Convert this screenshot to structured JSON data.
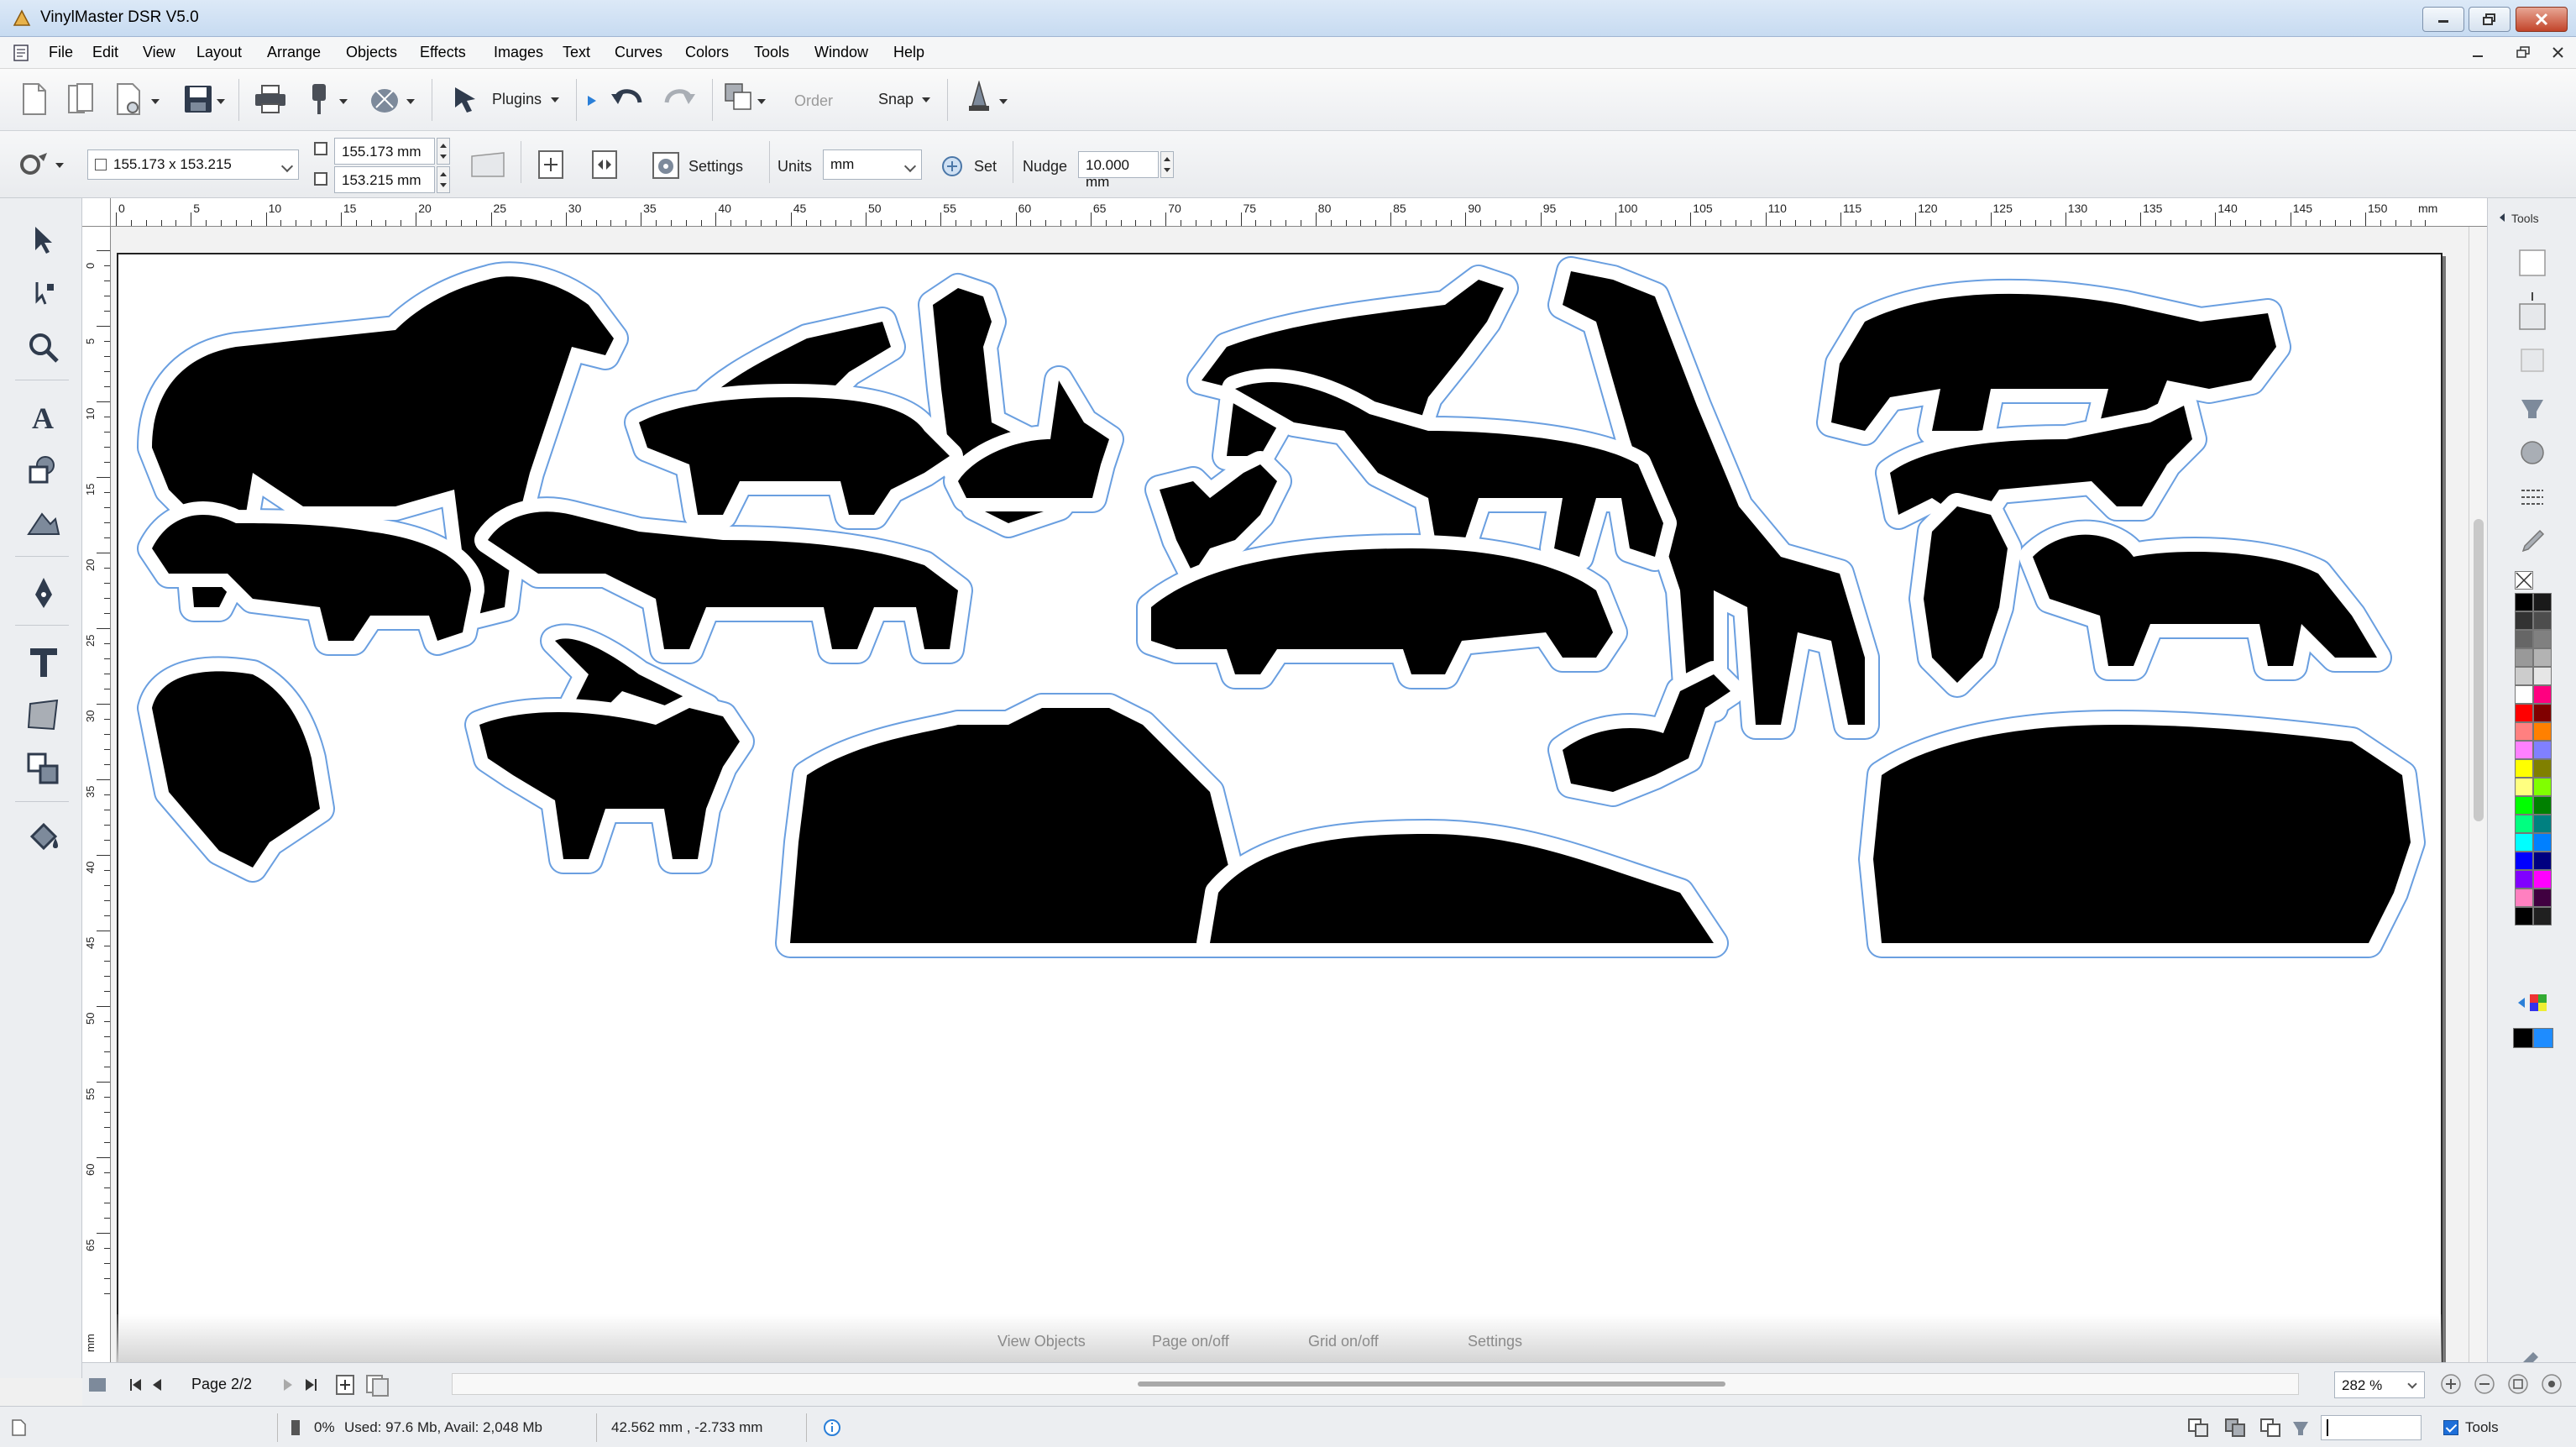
{
  "window": {
    "title": "VinylMaster DSR V5.0"
  },
  "menu": [
    "File",
    "Edit",
    "View",
    "Layout",
    "Arrange",
    "Objects",
    "Effects",
    "Images",
    "Text",
    "Curves",
    "Colors",
    "Tools",
    "Window",
    "Help"
  ],
  "toolbar": {
    "plugins_label": "Plugins",
    "order_label": "Order",
    "snap_label": "Snap"
  },
  "propbar": {
    "size_value": "155.173 x 153.215",
    "width_value": "155.173 mm",
    "height_value": "153.215 mm",
    "settings_label": "Settings",
    "units_label": "Units",
    "units_value": "mm",
    "set_label": "Set",
    "nudge_label": "Nudge",
    "nudge_value": "10.000 mm"
  },
  "ruler": {
    "h_ticks": [
      "0",
      "5",
      "10",
      "15",
      "20",
      "25",
      "30",
      "35",
      "40",
      "45",
      "50",
      "55",
      "60",
      "65",
      "70",
      "75",
      "80",
      "85",
      "90",
      "95",
      "100",
      "105",
      "110",
      "115",
      "120",
      "125",
      "130",
      "135",
      "140",
      "145",
      "150"
    ],
    "h_unit": "mm",
    "v_ticks": [
      "0",
      "5",
      "10",
      "15",
      "20",
      "25",
      "30",
      "35",
      "40",
      "45",
      "50",
      "55",
      "60",
      "65"
    ],
    "v_unit": "mm"
  },
  "overlay": {
    "view_objects": "View Objects",
    "page_onoff": "Page on/off",
    "grid_onoff": "Grid on/off",
    "settings": "Settings"
  },
  "pagebar": {
    "page_label": "Page 2/2",
    "zoom_value": "282 %"
  },
  "status": {
    "progress": "0%",
    "memory": "Used: 97.6 Mb, Avail: 2,048 Mb",
    "coords": "42.562 mm , -2.733 mm",
    "tools_label": "Tools"
  },
  "dock": {
    "tools_tab": "Tools"
  },
  "palette": {
    "colors": [
      "#000000",
      "#1a1a1a",
      "#333333",
      "#4d4d4d",
      "#666666",
      "#808080",
      "#999999",
      "#b3b3b3",
      "#cccccc",
      "#e6e6e6",
      "#ffffff",
      "#ff0080",
      "#ff0000",
      "#800000",
      "#ff8080",
      "#ff8000",
      "#ff80ff",
      "#8080ff",
      "#ffff00",
      "#808000",
      "#ffff80",
      "#80ff00",
      "#00ff00",
      "#008000",
      "#00ff80",
      "#008080",
      "#00ffff",
      "#0080ff",
      "#0000ff",
      "#000080",
      "#8000ff",
      "#ff00ff",
      "#ff80c0",
      "#400040",
      "#000000",
      "#202020"
    ]
  }
}
